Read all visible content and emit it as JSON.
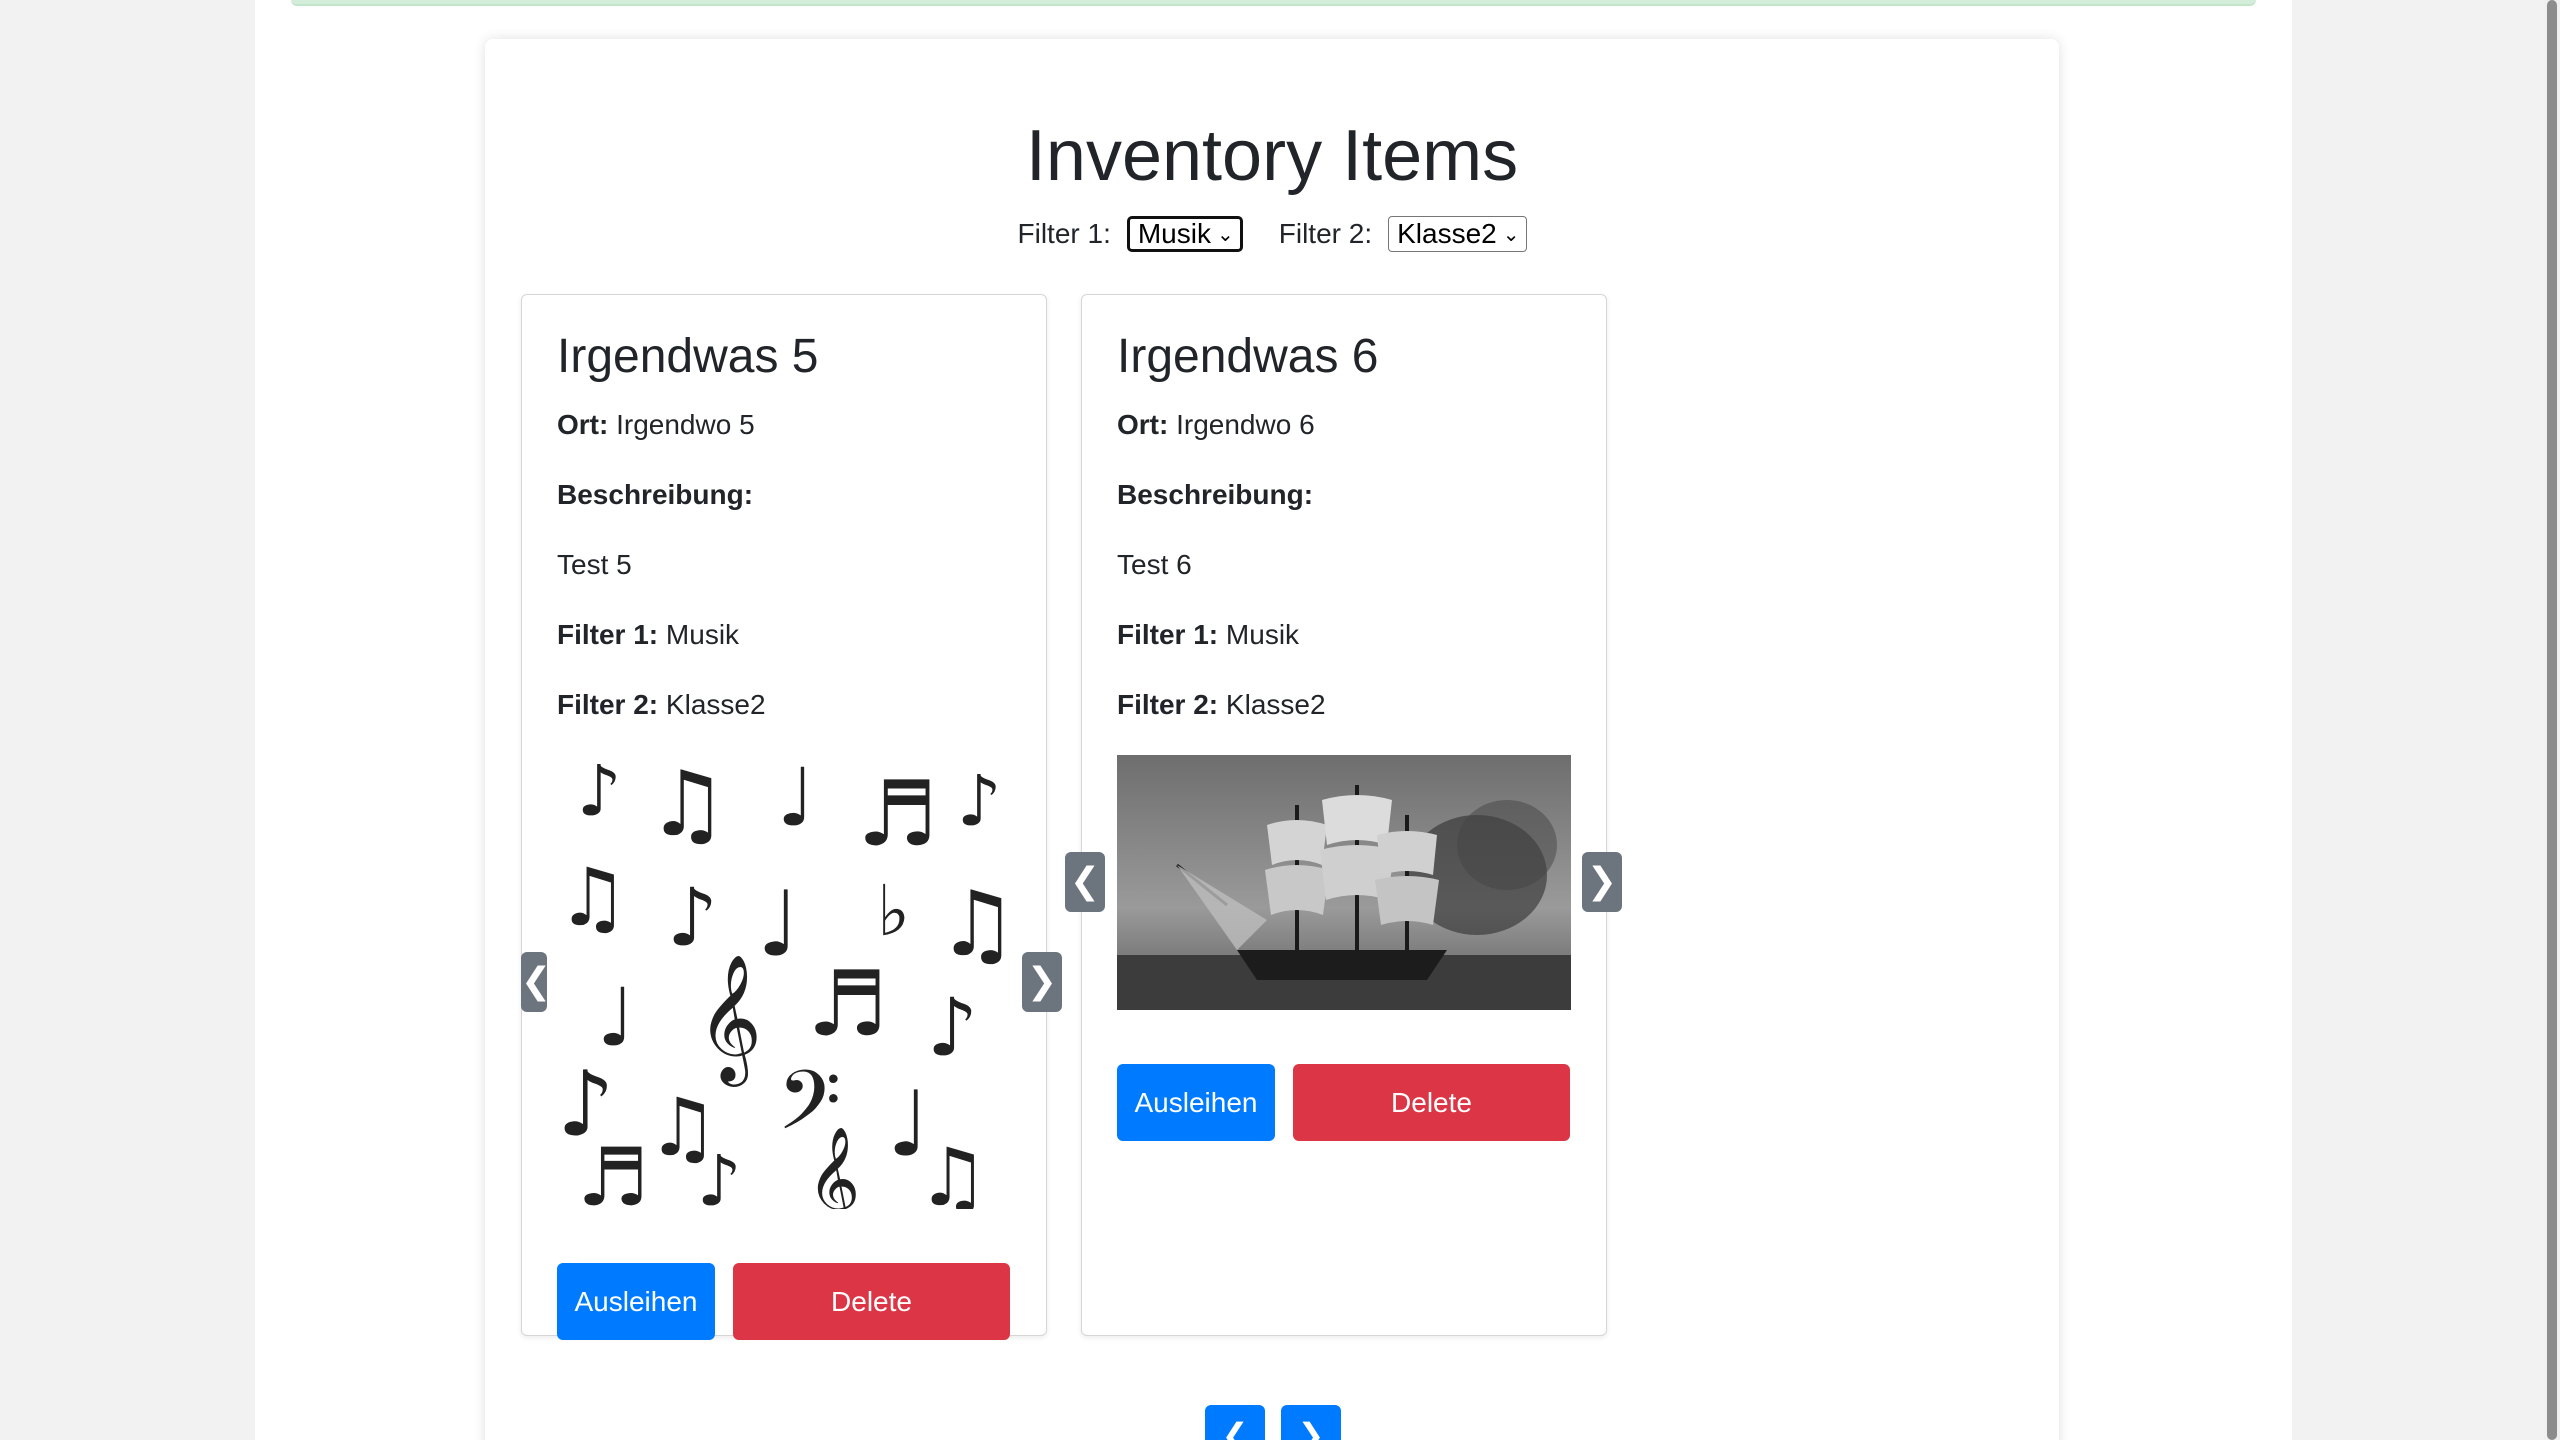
{
  "page": {
    "title": "Inventory Items"
  },
  "filters": {
    "filter1_label": "Filter 1:",
    "filter1_value": "Musik",
    "filter2_label": "Filter 2:",
    "filter2_value": "Klasse2"
  },
  "items": [
    {
      "title": "Irgendwas 5",
      "ort_label": "Ort:",
      "ort_value": "Irgendwo 5",
      "beschreibung_label": "Beschreibung:",
      "beschreibung_value": "Test 5",
      "filter1_label": "Filter 1:",
      "filter1_value": "Musik",
      "filter2_label": "Filter 2:",
      "filter2_value": "Klasse2",
      "lend_label": "Ausleihen",
      "delete_label": "Delete"
    },
    {
      "title": "Irgendwas 6",
      "ort_label": "Ort:",
      "ort_value": "Irgendwo 6",
      "beschreibung_label": "Beschreibung:",
      "beschreibung_value": "Test 6",
      "filter1_label": "Filter 1:",
      "filter1_value": "Musik",
      "filter2_label": "Filter 2:",
      "filter2_value": "Klasse2",
      "lend_label": "Ausleihen",
      "delete_label": "Delete"
    }
  ],
  "slider": {
    "prev_glyph": "❮",
    "next_glyph": "❯"
  },
  "pagination": {
    "prev_glyph": "❮",
    "next_glyph": "❯"
  },
  "colors": {
    "primary": "#007bff",
    "danger": "#dc3545",
    "nav": "#6c757d"
  }
}
